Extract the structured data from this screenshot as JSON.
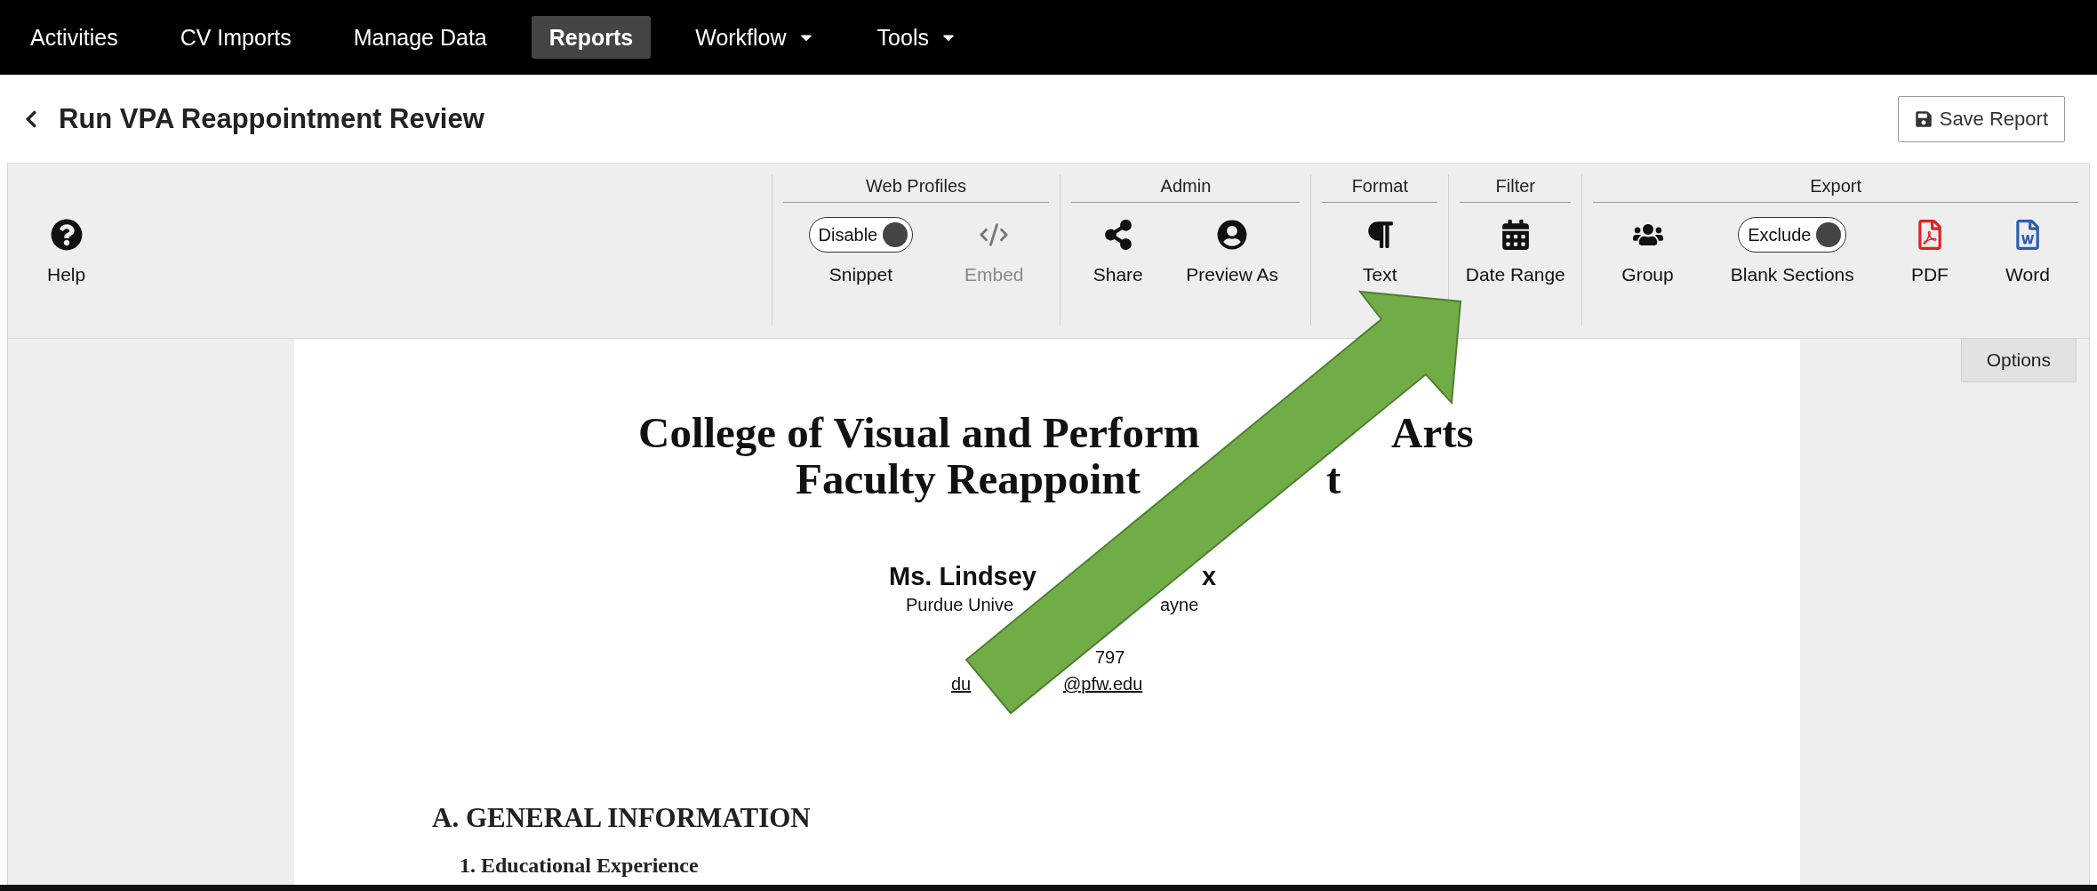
{
  "nav": [
    {
      "label": "Activities",
      "selected": false,
      "dropdown": false
    },
    {
      "label": "CV Imports",
      "selected": false,
      "dropdown": false
    },
    {
      "label": "Manage Data",
      "selected": false,
      "dropdown": false
    },
    {
      "label": "Reports",
      "selected": true,
      "dropdown": false
    },
    {
      "label": "Workflow",
      "selected": false,
      "dropdown": true
    },
    {
      "label": "Tools",
      "selected": false,
      "dropdown": true
    }
  ],
  "page_title": "Run VPA Reappointment Review",
  "save_button": "Save Report",
  "toolbar": {
    "help": "Help",
    "groups": [
      {
        "title": "Web Profiles",
        "items": [
          {
            "kind": "toggle",
            "toggle_label": "Disable",
            "on": true,
            "label": "Snippet",
            "disabled": false
          },
          {
            "kind": "icon",
            "label": "Embed",
            "disabled": true
          }
        ]
      },
      {
        "title": "Admin",
        "items": [
          {
            "kind": "icon",
            "label": "Share",
            "disabled": false
          },
          {
            "kind": "icon",
            "label": "Preview As",
            "disabled": false
          }
        ]
      },
      {
        "title": "Format",
        "items": [
          {
            "kind": "icon",
            "label": "Text",
            "disabled": false
          }
        ]
      },
      {
        "title": "Filter",
        "items": [
          {
            "kind": "icon",
            "label": "Date Range",
            "disabled": false
          }
        ]
      },
      {
        "title": "Export",
        "items": [
          {
            "kind": "icon",
            "label": "Group",
            "disabled": false
          },
          {
            "kind": "toggle",
            "toggle_label": "Exclude",
            "on": true,
            "label": "Blank Sections",
            "disabled": false
          },
          {
            "kind": "icon",
            "label": "PDF",
            "disabled": false
          },
          {
            "kind": "icon",
            "label": "Word",
            "disabled": false
          }
        ]
      }
    ]
  },
  "options_tab": "Options",
  "document": {
    "title_lines": [
      {
        "parts": [
          "College of Visual and Perform",
          "Arts"
        ]
      },
      {
        "parts": [
          "Faculty Reappoint",
          "t"
        ]
      }
    ],
    "contact_lines": [
      {
        "kind": "name",
        "parts": [
          "Ms. Lindsey",
          "x"
        ]
      },
      {
        "kind": "text",
        "parts": [
          "Purdue Unive",
          "ayne"
        ]
      },
      {
        "kind": "text",
        "parts": [
          "797"
        ]
      },
      {
        "kind": "email",
        "parts": [
          "du",
          "@pfw.edu"
        ]
      }
    ],
    "section_heading": "A. GENERAL INFORMATION",
    "subsection_heading": "1. Educational Experience"
  }
}
